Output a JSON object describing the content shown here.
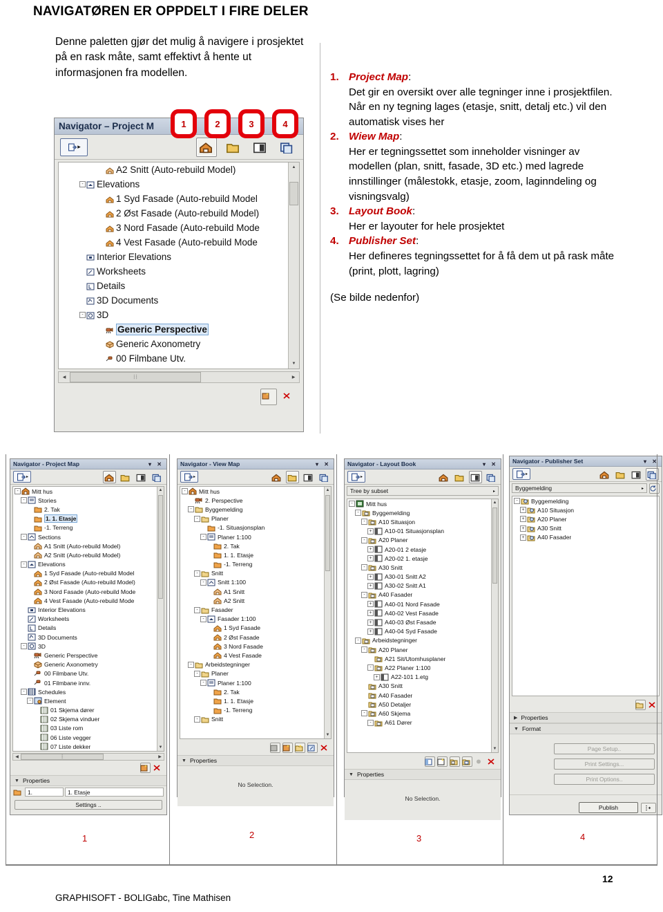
{
  "headline": "NAVIGATØREN ER OPPDELT I FIRE DELER",
  "intro": "Denne paletten gjør det mulig å navigere i prosjektet på en rask måte, samt effektivt å hente ut informasjonen fra modellen.",
  "list": [
    {
      "num": "1.",
      "title": "Project Map",
      "colon": ":",
      "text": "Det gir en oversikt over alle tegninger inne i prosjektfilen. Når en ny tegning lages (etasje, snitt, detalj etc.) vil den automatisk vises her"
    },
    {
      "num": "2.",
      "title": "Wiew Map",
      "colon": ":",
      "text": "Her er tegningssettet som inneholder visninger av modellen (plan, snitt, fasade, 3D etc.) med lagrede innstillinger (målestokk, etasje, zoom, laginndeling og visningsvalg)"
    },
    {
      "num": "3.",
      "title": "Layout Book",
      "colon": ":",
      "text": "Her er layouter for hele prosjektet"
    },
    {
      "num": "4.",
      "title": "Publisher Set",
      "colon": ":",
      "text": "Her defineres tegningssettet for å få dem ut på rask måte (print, plott, lagring)"
    }
  ],
  "see_below": "(Se bilde nedenfor)",
  "callouts": [
    "1",
    "2",
    "3",
    "4"
  ],
  "colors": {
    "accent_red": "#c00000",
    "badge_red": "#e3000b",
    "title_blue": "#1b2d4b"
  },
  "main_palette": {
    "title": "Navigator – Project M",
    "window_controls": "▾ ✕",
    "tabs": [
      {
        "name": "project-map",
        "label": "Project Map",
        "active": true
      },
      {
        "name": "view-map",
        "label": "View Map",
        "active": false
      },
      {
        "name": "layout-book",
        "label": "Layout Book",
        "active": false
      },
      {
        "name": "publisher-set",
        "label": "Publisher Set",
        "active": false
      }
    ],
    "tree": [
      {
        "indent": 4,
        "toggle": "",
        "icon": "section-icon",
        "label": "A2 Snitt (Auto-rebuild Model)"
      },
      {
        "indent": 2,
        "toggle": "-",
        "icon": "elevation-folder-icon",
        "label": "Elevations"
      },
      {
        "indent": 4,
        "toggle": "",
        "icon": "elevation-icon",
        "label": "1 Syd Fasade (Auto-rebuild Model"
      },
      {
        "indent": 4,
        "toggle": "",
        "icon": "elevation-icon",
        "label": "2 Øst Fasade (Auto-rebuild Model)"
      },
      {
        "indent": 4,
        "toggle": "",
        "icon": "elevation-icon",
        "label": "3 Nord Fasade (Auto-rebuild Mode"
      },
      {
        "indent": 4,
        "toggle": "",
        "icon": "elevation-icon",
        "label": "4 Vest Fasade (Auto-rebuild Mode"
      },
      {
        "indent": 2,
        "toggle": "",
        "icon": "interior-elevation-icon",
        "label": "Interior Elevations"
      },
      {
        "indent": 2,
        "toggle": "",
        "icon": "worksheet-icon",
        "label": "Worksheets"
      },
      {
        "indent": 2,
        "toggle": "",
        "icon": "detail-icon",
        "label": "Details"
      },
      {
        "indent": 2,
        "toggle": "",
        "icon": "3d-document-icon",
        "label": "3D Documents"
      },
      {
        "indent": 2,
        "toggle": "-",
        "icon": "3d-icon",
        "label": "3D"
      },
      {
        "indent": 4,
        "toggle": "",
        "icon": "camera-icon",
        "label": "Generic Perspective",
        "selected": true
      },
      {
        "indent": 4,
        "toggle": "",
        "icon": "axonometry-icon",
        "label": "Generic Axonometry"
      },
      {
        "indent": 4,
        "toggle": "",
        "icon": "camera-path-icon",
        "label": "00 Filmbane Utv."
      }
    ]
  },
  "panels": [
    {
      "id": "project-map",
      "title": "Navigator - Project Map",
      "window_controls": "▾ ✕",
      "active_tab": 0,
      "combo": null,
      "tree": [
        {
          "indent": 0,
          "toggle": "-",
          "icon": "home-icon",
          "label": "Mitt hus"
        },
        {
          "indent": 1,
          "toggle": "-",
          "icon": "stories-icon",
          "label": "Stories"
        },
        {
          "indent": 2,
          "toggle": "",
          "icon": "story-icon",
          "label": "2. Tak"
        },
        {
          "indent": 2,
          "toggle": "",
          "icon": "story-icon",
          "label": "1. 1. Etasje",
          "selected": true
        },
        {
          "indent": 2,
          "toggle": "",
          "icon": "story-icon",
          "label": "-1. Terreng"
        },
        {
          "indent": 1,
          "toggle": "-",
          "icon": "section-folder-icon",
          "label": "Sections"
        },
        {
          "indent": 2,
          "toggle": "",
          "icon": "section-icon",
          "label": "A1 Snitt (Auto-rebuild Model)"
        },
        {
          "indent": 2,
          "toggle": "",
          "icon": "section-icon",
          "label": "A2 Snitt (Auto-rebuild Model)"
        },
        {
          "indent": 1,
          "toggle": "-",
          "icon": "elevation-folder-icon",
          "label": "Elevations"
        },
        {
          "indent": 2,
          "toggle": "",
          "icon": "elevation-icon",
          "label": "1 Syd Fasade (Auto-rebuild Model"
        },
        {
          "indent": 2,
          "toggle": "",
          "icon": "elevation-icon",
          "label": "2 Øst Fasade (Auto-rebuild Model)"
        },
        {
          "indent": 2,
          "toggle": "",
          "icon": "elevation-icon",
          "label": "3 Nord Fasade (Auto-rebuild Mode"
        },
        {
          "indent": 2,
          "toggle": "",
          "icon": "elevation-icon",
          "label": "4 Vest Fasade (Auto-rebuild Mode"
        },
        {
          "indent": 1,
          "toggle": "",
          "icon": "interior-elevation-icon",
          "label": "Interior Elevations"
        },
        {
          "indent": 1,
          "toggle": "",
          "icon": "worksheet-icon",
          "label": "Worksheets"
        },
        {
          "indent": 1,
          "toggle": "",
          "icon": "detail-icon",
          "label": "Details"
        },
        {
          "indent": 1,
          "toggle": "",
          "icon": "3d-document-icon",
          "label": "3D Documents"
        },
        {
          "indent": 1,
          "toggle": "-",
          "icon": "3d-icon",
          "label": "3D"
        },
        {
          "indent": 2,
          "toggle": "",
          "icon": "camera-icon",
          "label": "Generic Perspective"
        },
        {
          "indent": 2,
          "toggle": "",
          "icon": "axonometry-icon",
          "label": "Generic Axonometry"
        },
        {
          "indent": 2,
          "toggle": "",
          "icon": "camera-path-icon",
          "label": "00 Filmbane Utv."
        },
        {
          "indent": 2,
          "toggle": "",
          "icon": "camera-path-icon",
          "label": "01 Filmbane innv."
        },
        {
          "indent": 1,
          "toggle": "-",
          "icon": "schedules-icon",
          "label": "Schedules"
        },
        {
          "indent": 2,
          "toggle": "-",
          "icon": "element-icon",
          "label": "Element"
        },
        {
          "indent": 3,
          "toggle": "",
          "icon": "schedule-icon",
          "label": "01 Skjema dører"
        },
        {
          "indent": 3,
          "toggle": "",
          "icon": "schedule-icon",
          "label": "02 Skjema vinduer"
        },
        {
          "indent": 3,
          "toggle": "",
          "icon": "schedule-icon",
          "label": "03 Liste rom"
        },
        {
          "indent": 3,
          "toggle": "",
          "icon": "schedule-icon",
          "label": "06 Liste vegger"
        },
        {
          "indent": 3,
          "toggle": "",
          "icon": "schedule-icon",
          "label": "07 Liste dekker"
        }
      ],
      "action_buttons": [
        "new-view-icon",
        "delete-icon"
      ],
      "properties_label": "Properties",
      "properties_open": true,
      "field_left": "1.",
      "field_right": "1. Etasje",
      "settings_label": "Settings ..",
      "no_selection": null,
      "format_label": null
    },
    {
      "id": "view-map",
      "title": "Navigator - View Map",
      "window_controls": "▾ ✕",
      "active_tab": 1,
      "combo": null,
      "tree": [
        {
          "indent": 0,
          "toggle": "-",
          "icon": "home-icon",
          "label": "Mitt hus"
        },
        {
          "indent": 1,
          "toggle": "",
          "icon": "camera-icon",
          "label": "2. Perspective"
        },
        {
          "indent": 1,
          "toggle": "-",
          "icon": "folder-icon",
          "label": "Byggemelding"
        },
        {
          "indent": 2,
          "toggle": "-",
          "icon": "folder-icon",
          "label": "Planer"
        },
        {
          "indent": 3,
          "toggle": "",
          "icon": "story-icon",
          "label": "-1. Situasjonsplan"
        },
        {
          "indent": 3,
          "toggle": "-",
          "icon": "stories-icon",
          "label": "Planer 1:100"
        },
        {
          "indent": 4,
          "toggle": "",
          "icon": "story-icon",
          "label": "2. Tak"
        },
        {
          "indent": 4,
          "toggle": "",
          "icon": "story-icon",
          "label": "1. 1. Etasje"
        },
        {
          "indent": 4,
          "toggle": "",
          "icon": "story-icon",
          "label": "-1. Terreng"
        },
        {
          "indent": 2,
          "toggle": "-",
          "icon": "folder-icon",
          "label": "Snitt"
        },
        {
          "indent": 3,
          "toggle": "-",
          "icon": "section-folder-icon",
          "label": "Snitt 1:100"
        },
        {
          "indent": 4,
          "toggle": "",
          "icon": "section-icon",
          "label": "A1 Snitt"
        },
        {
          "indent": 4,
          "toggle": "",
          "icon": "section-icon",
          "label": "A2 Snitt"
        },
        {
          "indent": 2,
          "toggle": "-",
          "icon": "folder-icon",
          "label": "Fasader"
        },
        {
          "indent": 3,
          "toggle": "-",
          "icon": "elevation-folder-icon",
          "label": "Fasader 1:100"
        },
        {
          "indent": 4,
          "toggle": "",
          "icon": "elevation-icon",
          "label": "1 Syd Fasade"
        },
        {
          "indent": 4,
          "toggle": "",
          "icon": "elevation-icon",
          "label": "2 Øst Fasade"
        },
        {
          "indent": 4,
          "toggle": "",
          "icon": "elevation-icon",
          "label": "3 Nord Fasade"
        },
        {
          "indent": 4,
          "toggle": "",
          "icon": "elevation-icon",
          "label": "4 Vest Fasade"
        },
        {
          "indent": 1,
          "toggle": "-",
          "icon": "folder-icon",
          "label": "Arbeidstegninger"
        },
        {
          "indent": 2,
          "toggle": "-",
          "icon": "folder-icon",
          "label": "Planer"
        },
        {
          "indent": 3,
          "toggle": "-",
          "icon": "stories-icon",
          "label": "Planer 1:100"
        },
        {
          "indent": 4,
          "toggle": "",
          "icon": "story-icon",
          "label": "2. Tak"
        },
        {
          "indent": 4,
          "toggle": "",
          "icon": "story-icon",
          "label": "1. 1. Etasje"
        },
        {
          "indent": 4,
          "toggle": "",
          "icon": "story-icon",
          "label": "-1. Terreng"
        },
        {
          "indent": 2,
          "toggle": "-",
          "icon": "folder-icon",
          "label": "Snitt"
        }
      ],
      "action_buttons": [
        "clone-folder-icon",
        "new-view-icon",
        "new-folder-icon",
        "redefine-icon",
        "delete-icon"
      ],
      "properties_label": "Properties",
      "properties_open": true,
      "no_selection": "No Selection.",
      "field_left": null,
      "field_right": null,
      "settings_label": null,
      "format_label": null
    },
    {
      "id": "layout-book",
      "title": "Navigator - Layout Book",
      "window_controls": "▾ ✕",
      "active_tab": 2,
      "combo": "Tree by subset",
      "tree": [
        {
          "indent": 0,
          "toggle": "-",
          "icon": "layoutbook-icon",
          "label": "Mitt hus"
        },
        {
          "indent": 1,
          "toggle": "-",
          "icon": "subset-icon",
          "label": "Byggemelding"
        },
        {
          "indent": 2,
          "toggle": "-",
          "icon": "subset-icon",
          "label": "A10 Situasjon"
        },
        {
          "indent": 3,
          "toggle": "+",
          "icon": "layout-icon",
          "label": "A10-01 Situasjonsplan"
        },
        {
          "indent": 2,
          "toggle": "-",
          "icon": "subset-icon",
          "label": "A20 Planer"
        },
        {
          "indent": 3,
          "toggle": "+",
          "icon": "layout-icon",
          "label": "A20-01 2 etasje"
        },
        {
          "indent": 3,
          "toggle": "+",
          "icon": "layout-icon",
          "label": "A20-02 1. etasje"
        },
        {
          "indent": 2,
          "toggle": "-",
          "icon": "subset-icon",
          "label": "A30 Snitt"
        },
        {
          "indent": 3,
          "toggle": "+",
          "icon": "layout-icon",
          "label": "A30-01 Snitt A2"
        },
        {
          "indent": 3,
          "toggle": "+",
          "icon": "layout-icon",
          "label": "A30-02 Snitt A1"
        },
        {
          "indent": 2,
          "toggle": "-",
          "icon": "subset-icon",
          "label": "A40 Fasader"
        },
        {
          "indent": 3,
          "toggle": "+",
          "icon": "layout-icon",
          "label": "A40-01 Nord Fasade"
        },
        {
          "indent": 3,
          "toggle": "+",
          "icon": "layout-icon",
          "label": "A40-02 Vest Fasade"
        },
        {
          "indent": 3,
          "toggle": "+",
          "icon": "layout-icon",
          "label": "A40-03 Øst Fasade"
        },
        {
          "indent": 3,
          "toggle": "+",
          "icon": "layout-icon",
          "label": "A40-04 Syd Fasade"
        },
        {
          "indent": 1,
          "toggle": "-",
          "icon": "subset-icon",
          "label": "Arbeidstegninger"
        },
        {
          "indent": 2,
          "toggle": "-",
          "icon": "subset-icon",
          "label": "A20 Planer"
        },
        {
          "indent": 3,
          "toggle": "",
          "icon": "subset-icon",
          "label": "A21 Sit/Utomhusplaner"
        },
        {
          "indent": 3,
          "toggle": "-",
          "icon": "subset-icon",
          "label": "A22 Planer 1:100"
        },
        {
          "indent": 4,
          "toggle": "+",
          "icon": "layout-icon",
          "label": "A22-101 1.etg"
        },
        {
          "indent": 2,
          "toggle": "",
          "icon": "subset-icon",
          "label": "A30 Snitt"
        },
        {
          "indent": 2,
          "toggle": "",
          "icon": "subset-icon",
          "label": "A40 Fasader"
        },
        {
          "indent": 2,
          "toggle": "",
          "icon": "subset-icon",
          "label": "A50 Detaljer"
        },
        {
          "indent": 2,
          "toggle": "-",
          "icon": "subset-icon",
          "label": "A60 Skjema"
        },
        {
          "indent": 3,
          "toggle": "-",
          "icon": "subset-icon",
          "label": "A61 Dører"
        }
      ],
      "action_buttons": [
        "master-layout-icon",
        "new-layout-icon",
        "new-subset-icon",
        "new-masterlayout-icon",
        "dot-icon",
        "delete-icon"
      ],
      "properties_label": "Properties",
      "properties_open": true,
      "no_selection": "No Selection.",
      "field_left": null,
      "field_right": null,
      "settings_label": null,
      "format_label": null
    },
    {
      "id": "publisher-set",
      "title": "Navigator - Publisher Set",
      "window_controls": "▾ ✕",
      "active_tab": 3,
      "combo": "Byggemelding",
      "combo_extra_button": "refresh-icon",
      "tree": [
        {
          "indent": 0,
          "toggle": "-",
          "icon": "publisher-icon",
          "label": "Byggemelding"
        },
        {
          "indent": 1,
          "toggle": "+",
          "icon": "publisher-icon",
          "label": "A10 Situasjon"
        },
        {
          "indent": 1,
          "toggle": "+",
          "icon": "publisher-icon",
          "label": "A20 Planer"
        },
        {
          "indent": 1,
          "toggle": "+",
          "icon": "publisher-icon",
          "label": "A30 Snitt"
        },
        {
          "indent": 1,
          "toggle": "+",
          "icon": "publisher-icon",
          "label": "A40 Fasader"
        }
      ],
      "action_buttons": [
        "new-publisher-folder-icon",
        "delete-icon"
      ],
      "properties_label": "Properties",
      "properties_open": false,
      "format_label": "Format",
      "format_open": true,
      "format_buttons": [
        "Page Setup..",
        "Print Settings...",
        "Print Options.."
      ],
      "publish_label": "Publish",
      "publish_menu": "options-icon",
      "no_selection": null,
      "field_left": null,
      "field_right": null,
      "settings_label": null
    }
  ],
  "cell_numbers": [
    "1",
    "2",
    "3",
    "4"
  ],
  "footer": "GRAPHISOFT - BOLIGabc, Tine Mathisen",
  "page_number": "12"
}
